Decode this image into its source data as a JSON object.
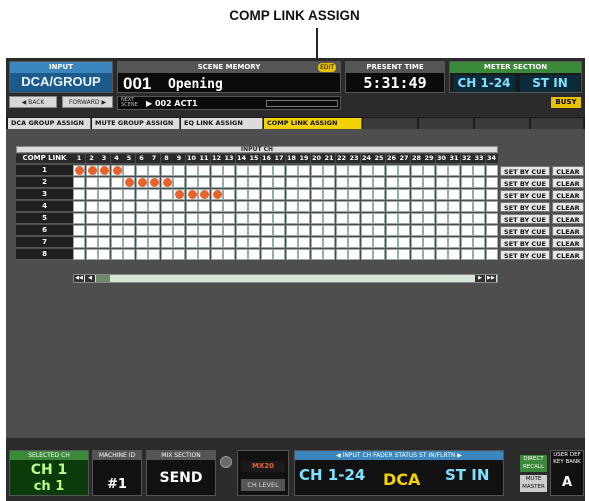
{
  "callout": "COMP LINK ASSIGN",
  "header": {
    "mode_label": "INPUT",
    "mode_value": "DCA/GROUP",
    "back_label": "◀ BACK",
    "forward_label": "FORWARD ▶",
    "scene_label": "SCENE MEMORY",
    "edit_tag": "EDIT",
    "scene_number": "001",
    "scene_title": "Opening",
    "next_label": "NEXT SCENE",
    "next_value": "▶ 002 ACT1",
    "time_label": "PRESENT TIME",
    "time_value": "5:31:49",
    "meter_label": "METER SECTION",
    "meter_a": "CH 1-24",
    "meter_b": "ST IN",
    "busy": "BUSY"
  },
  "tabs": [
    {
      "label": "DCA GROUP ASSIGN",
      "active": false
    },
    {
      "label": "MUTE GROUP ASSIGN",
      "active": false
    },
    {
      "label": "EQ LINK ASSIGN",
      "active": false
    },
    {
      "label": "COMP LINK ASSIGN",
      "active": true
    }
  ],
  "grid": {
    "section_label": "INPUT CH",
    "row_header": "COMP LINK",
    "columns": [
      "1",
      "2",
      "3",
      "4",
      "5",
      "6",
      "7",
      "8",
      "9",
      "10",
      "11",
      "12",
      "13",
      "14",
      "15",
      "16",
      "17",
      "18",
      "19",
      "20",
      "21",
      "22",
      "23",
      "24",
      "25",
      "26",
      "27",
      "28",
      "29",
      "30",
      "31",
      "32",
      "33",
      "34"
    ],
    "rows": [
      {
        "label": "1",
        "assigned": [
          1,
          2,
          3,
          4
        ]
      },
      {
        "label": "2",
        "assigned": [
          5,
          6,
          7,
          8
        ]
      },
      {
        "label": "3",
        "assigned": [
          9,
          10,
          11,
          12
        ]
      },
      {
        "label": "4",
        "assigned": []
      },
      {
        "label": "5",
        "assigned": []
      },
      {
        "label": "6",
        "assigned": []
      },
      {
        "label": "7",
        "assigned": []
      },
      {
        "label": "8",
        "assigned": []
      }
    ],
    "set_by_cue_label": "SET BY CUE",
    "clear_label": "CLEAR",
    "scroll_first": "◀◀",
    "scroll_prev": "◀",
    "scroll_next": "▶",
    "scroll_last": "▶▶"
  },
  "footer": {
    "selected_label": "SELECTED CH",
    "selected_ch": "CH 1",
    "selected_name": "ch 1",
    "machine_label": "MACHINE ID",
    "machine_value": "#1",
    "mix_label": "MIX SECTION",
    "mix_value": "SEND",
    "mx_tag": "MX20",
    "ch_level": "CH LEVEL",
    "fader_label": "◀ INPUT CH     FADER STATUS     ST IN/FLRTN ▶",
    "fader_ch": "CH 1-24",
    "fader_dca": "DCA",
    "fader_stin": "ST IN",
    "recall_label": "DIRECT RECALL",
    "mute_master_label": "MUTE MASTER",
    "udk_label": "USER DEF KEY BANK",
    "udk_value": "A"
  },
  "colors": {
    "assigned_dot": "#e8632a",
    "active_tab": "#f2d300",
    "mode_blue": "#1b5a8a"
  }
}
